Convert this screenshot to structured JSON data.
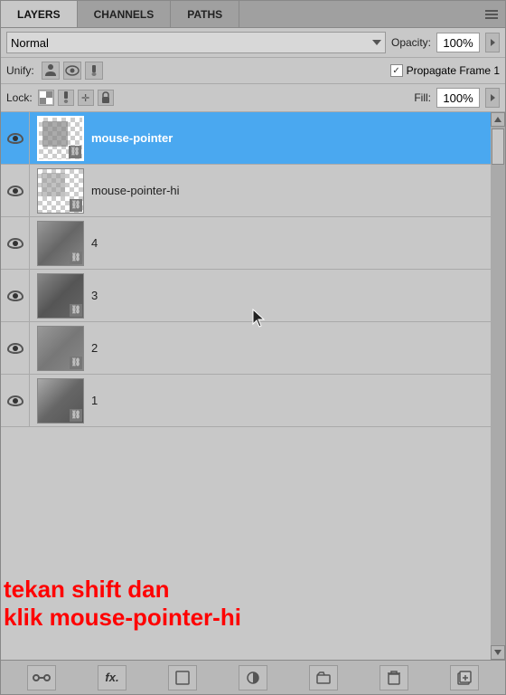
{
  "tabs": [
    {
      "label": "LAYERS",
      "active": true
    },
    {
      "label": "CHANNELS",
      "active": false
    },
    {
      "label": "PATHS",
      "active": false
    }
  ],
  "blend": {
    "mode": "Normal",
    "opacity_label": "Opacity:",
    "opacity_value": "100%"
  },
  "unify": {
    "label": "Unify:",
    "icons": [
      "person-icon",
      "eye-unify-icon",
      "brush-unify-icon"
    ],
    "propagate_label": "Propagate Frame 1",
    "checked": true
  },
  "lock": {
    "label": "Lock:",
    "icons": [
      "checker-lock",
      "brush-lock",
      "move-lock",
      "padlock"
    ],
    "fill_label": "Fill:",
    "fill_value": "100%"
  },
  "layers": [
    {
      "name": "mouse-pointer",
      "selected": true,
      "visible": true
    },
    {
      "name": "mouse-pointer-hi",
      "selected": false,
      "visible": true
    },
    {
      "name": "4",
      "selected": false,
      "visible": true
    },
    {
      "name": "3",
      "selected": false,
      "visible": true
    },
    {
      "name": "2",
      "selected": false,
      "visible": true
    },
    {
      "name": "1",
      "selected": false,
      "visible": true
    }
  ],
  "annotation": {
    "line1": "tekan shift dan",
    "line2": "klik mouse-pointer-hi"
  },
  "toolbar": {
    "buttons": [
      "link-icon",
      "fx-icon",
      "new-layer-icon",
      "gradient-icon",
      "square-icon",
      "trash-icon",
      "add-layer-icon"
    ]
  }
}
